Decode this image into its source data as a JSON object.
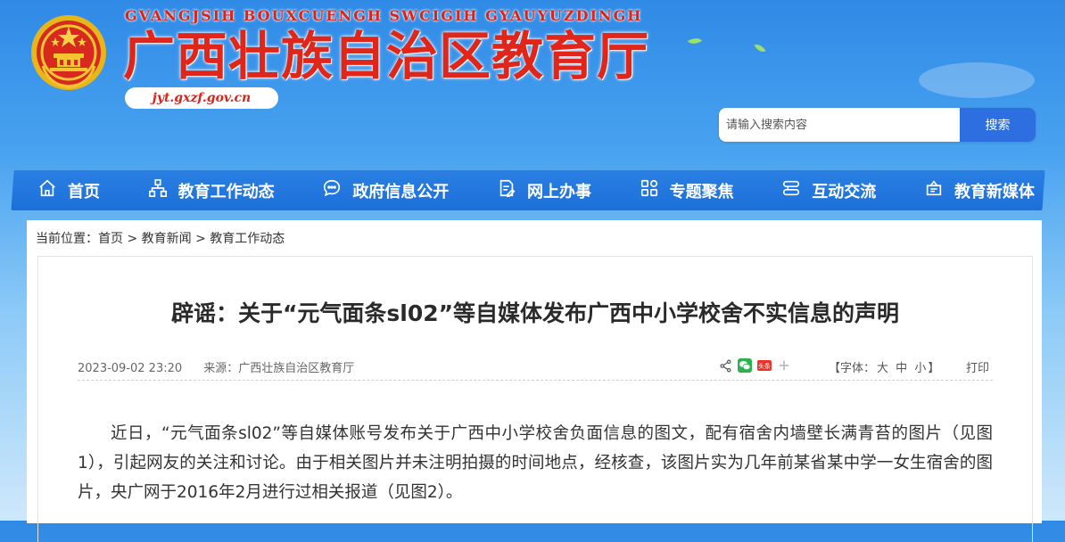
{
  "header": {
    "pinyin": "GVANGJSIH BOUXCUENGH SWCIGIH GYAUYUZDINGH",
    "title": "广西壮族自治区教育厅",
    "domain": "jyt.gxzf.gov.cn",
    "emblem": "national-emblem"
  },
  "search": {
    "placeholder": "请输入搜索内容",
    "button_label": "搜索"
  },
  "nav": {
    "items": [
      {
        "label": "首页",
        "icon": "home-icon"
      },
      {
        "label": "教育工作动态",
        "icon": "org-chart-icon"
      },
      {
        "label": "政府信息公开",
        "icon": "chat-bubble-icon"
      },
      {
        "label": "网上办事",
        "icon": "document-edit-icon"
      },
      {
        "label": "专题聚焦",
        "icon": "grid-icon"
      },
      {
        "label": "互动交流",
        "icon": "exchange-icon"
      },
      {
        "label": "教育新媒体",
        "icon": "media-icon"
      }
    ]
  },
  "breadcrumb": {
    "prefix": "当前位置：",
    "items": [
      "首页",
      "教育新闻",
      "教育工作动态"
    ],
    "separator": ">"
  },
  "article": {
    "title": "辟谣：关于“元气面条sl02”等自媒体发布广西中小学校舍不实信息的声明",
    "datetime": "2023-09-02 23:20",
    "source": "来源：广西壮族自治区教育厅",
    "font_size_label": "【字体：",
    "font_sizes": [
      "大",
      "中",
      "小"
    ],
    "font_size_end": "】",
    "print_label": "打印",
    "body": "近日，“元气面条sl02”等自媒体账号发布关于广西中小学校舍负面信息的图文，配有宿舍内墙壁长满青苔的图片（见图1），引起网友的关注和讨论。由于相关图片并未注明拍摄的时间地点，经核查，该图片实为几年前某省某中学一女生宿舍的图片，央广网于2016年2月进行过相关报道（见图2）。"
  },
  "share": {
    "icons": [
      "share-icon",
      "wechat-icon",
      "toutiao-icon",
      "plus-icon"
    ],
    "toutiao_text": "头条"
  },
  "colors": {
    "brand_red": "#e0251b",
    "nav_blue": "#1c6fd8",
    "search_blue": "#2d6fe0"
  }
}
